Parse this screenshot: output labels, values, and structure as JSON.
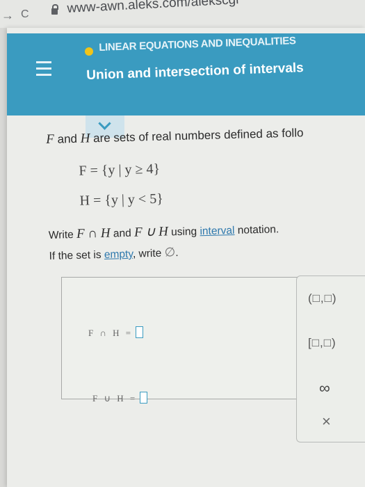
{
  "browser": {
    "back_icon": "arrow-right",
    "reload_icon": "reload",
    "url": "www-awn.aleks.com/alekscgi"
  },
  "header": {
    "topic": "LINEAR EQUATIONS AND INEQUALITIES",
    "lesson": "Union and intersection of intervals",
    "status_color": "#f0c419",
    "accent_color": "#3a9bc0"
  },
  "problem": {
    "intro_var1": "F",
    "intro_and": " and ",
    "intro_var2": "H",
    "intro_rest": " are sets of real numbers defined as follo",
    "F_def": "F = {y | y ≥ 4}",
    "H_def": "H = {y | y < 5}",
    "instr_write": "Write ",
    "instr_intersection": "F ∩ H",
    "instr_and": " and ",
    "instr_union": "F ∪ H",
    "instr_using": " using ",
    "instr_link": "interval",
    "instr_end": " notation.",
    "empty_pre": "If the set is ",
    "empty_link": "empty",
    "empty_mid": ", write ",
    "empty_symbol": "∅",
    "empty_end": "."
  },
  "answers": {
    "intersection_label": "F ∩ H =",
    "intersection_value": "",
    "union_label": "F ∪ H =",
    "union_value": ""
  },
  "keypad": {
    "open_interval": "(□,□)",
    "half_open_interval": "[□,□)",
    "infinity": "∞",
    "clear": "×"
  }
}
